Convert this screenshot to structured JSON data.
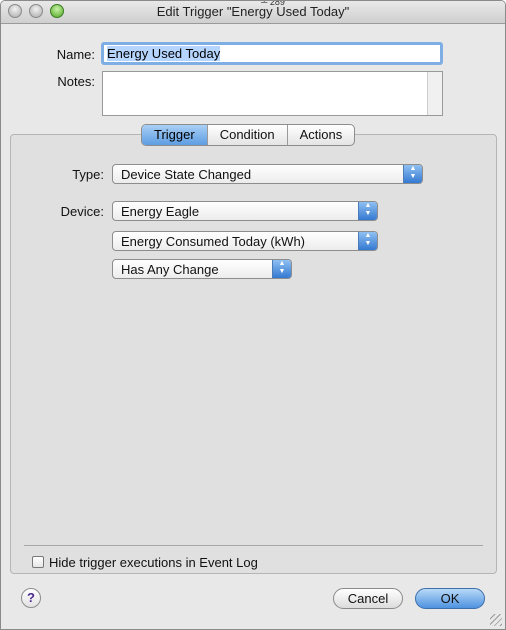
{
  "window": {
    "title": "Edit Trigger \"Energy Used Today\"",
    "cursor_readout": "289"
  },
  "form": {
    "name_label": "Name:",
    "name_value": "Energy Used Today",
    "notes_label": "Notes:",
    "notes_value": ""
  },
  "tabs": [
    {
      "label": "Trigger",
      "active": true
    },
    {
      "label": "Condition",
      "active": false
    },
    {
      "label": "Actions",
      "active": false
    }
  ],
  "trigger": {
    "type_label": "Type:",
    "type_value": "Device State Changed",
    "device_label": "Device:",
    "device_value": "Energy Eagle",
    "state_value": "Energy Consumed Today (kWh)",
    "change_value": "Has Any Change"
  },
  "options": {
    "hide_executions_label": "Hide trigger executions in Event Log",
    "hide_executions_checked": false
  },
  "footer": {
    "help_symbol": "?",
    "cancel_label": "Cancel",
    "ok_label": "OK"
  },
  "colors": {
    "accent": "#5d9de3",
    "window_bg": "#e8e8e8",
    "panel_bg": "#e0e0e0"
  }
}
